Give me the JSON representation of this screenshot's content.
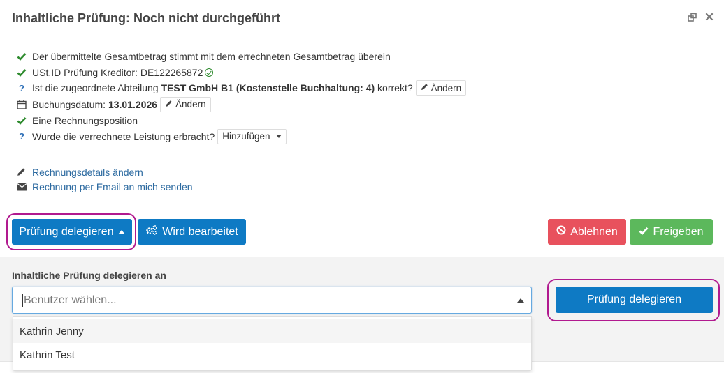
{
  "header": {
    "title": "Inhaltliche Prüfung: Noch nicht durchgeführt"
  },
  "checks": {
    "total_match": "Der übermittelte Gesamtbetrag stimmt mit dem errechneten Gesamtbetrag überein",
    "ustid_prefix": "USt.ID Prüfung Kreditor: DE122265872",
    "dept_prefix": "Ist die zugeordnete Abteilung ",
    "dept_name": "TEST GmbH B1 (Kostenstelle Buchhaltung: 4)",
    "dept_suffix": " korrekt?",
    "dept_change_label": "Ändern",
    "booking_prefix": "Buchungsdatum: ",
    "booking_date": "13.01.2026",
    "booking_change_label": "Ändern",
    "positions": "Eine Rechnungsposition",
    "service_question": "Wurde die verrechnete Leistung erbracht?",
    "service_add_label": "Hinzufügen"
  },
  "links": {
    "edit_details": "Rechnungsdetails ändern",
    "send_email": "Rechnung per Email an mich senden"
  },
  "actions": {
    "delegate_label": "Prüfung delegieren",
    "in_progress_label": "Wird bearbeitet",
    "reject_label": "Ablehnen",
    "approve_label": "Freigeben"
  },
  "delegate": {
    "label": "Inhaltliche Prüfung delegieren an",
    "placeholder": "Benutzer wählen...",
    "submit_label": "Prüfung delegieren",
    "options": [
      "Kathrin Jenny",
      "Kathrin Test"
    ]
  },
  "colors": {
    "primary": "#0e7ac4",
    "danger": "#e8515d",
    "success": "#5cb85c",
    "highlight": "#b1198f",
    "link": "#2c6aa0"
  }
}
